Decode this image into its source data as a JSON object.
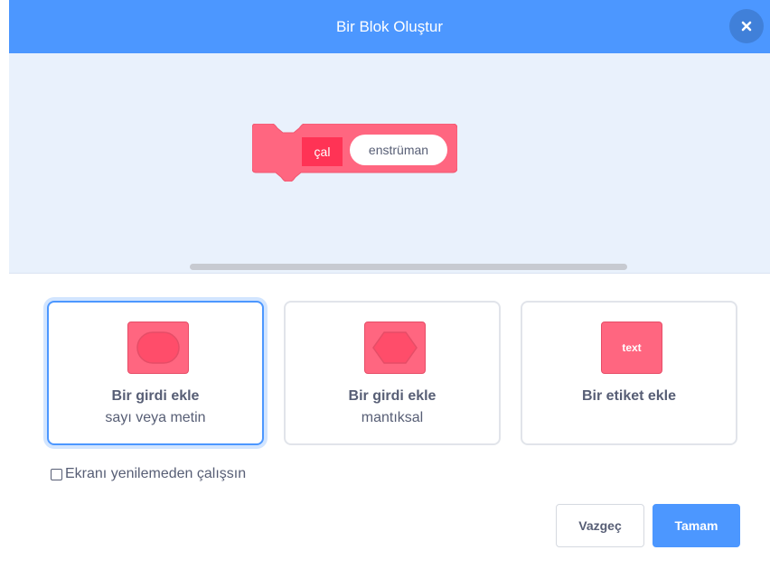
{
  "dialog": {
    "title": "Bir Blok Oluştur",
    "close_icon": "close-icon"
  },
  "block_preview": {
    "label": "çal",
    "parameter": "enstrüman",
    "color": "#ff6680",
    "label_highlight_color": "#ff3355"
  },
  "options": [
    {
      "title": "Bir girdi ekle",
      "subtitle": "sayı veya metin",
      "icon": "number-text-input-icon",
      "selected": true
    },
    {
      "title": "Bir girdi ekle",
      "subtitle": "mantıksal",
      "icon": "boolean-input-icon",
      "selected": false
    },
    {
      "title": "Bir etiket ekle",
      "icon": "label-text-icon",
      "icon_text": "text",
      "selected": false
    }
  ],
  "run_without_refresh": {
    "label": "Ekranı yenilemeden çalışsın",
    "checked": false
  },
  "buttons": {
    "cancel_label": "Vazgeç",
    "ok_label": "Tamam"
  },
  "colors": {
    "header": "#4c97ff",
    "workspace": "#e9f1fc",
    "accent": "#4c97ff",
    "block": "#ff6680"
  }
}
